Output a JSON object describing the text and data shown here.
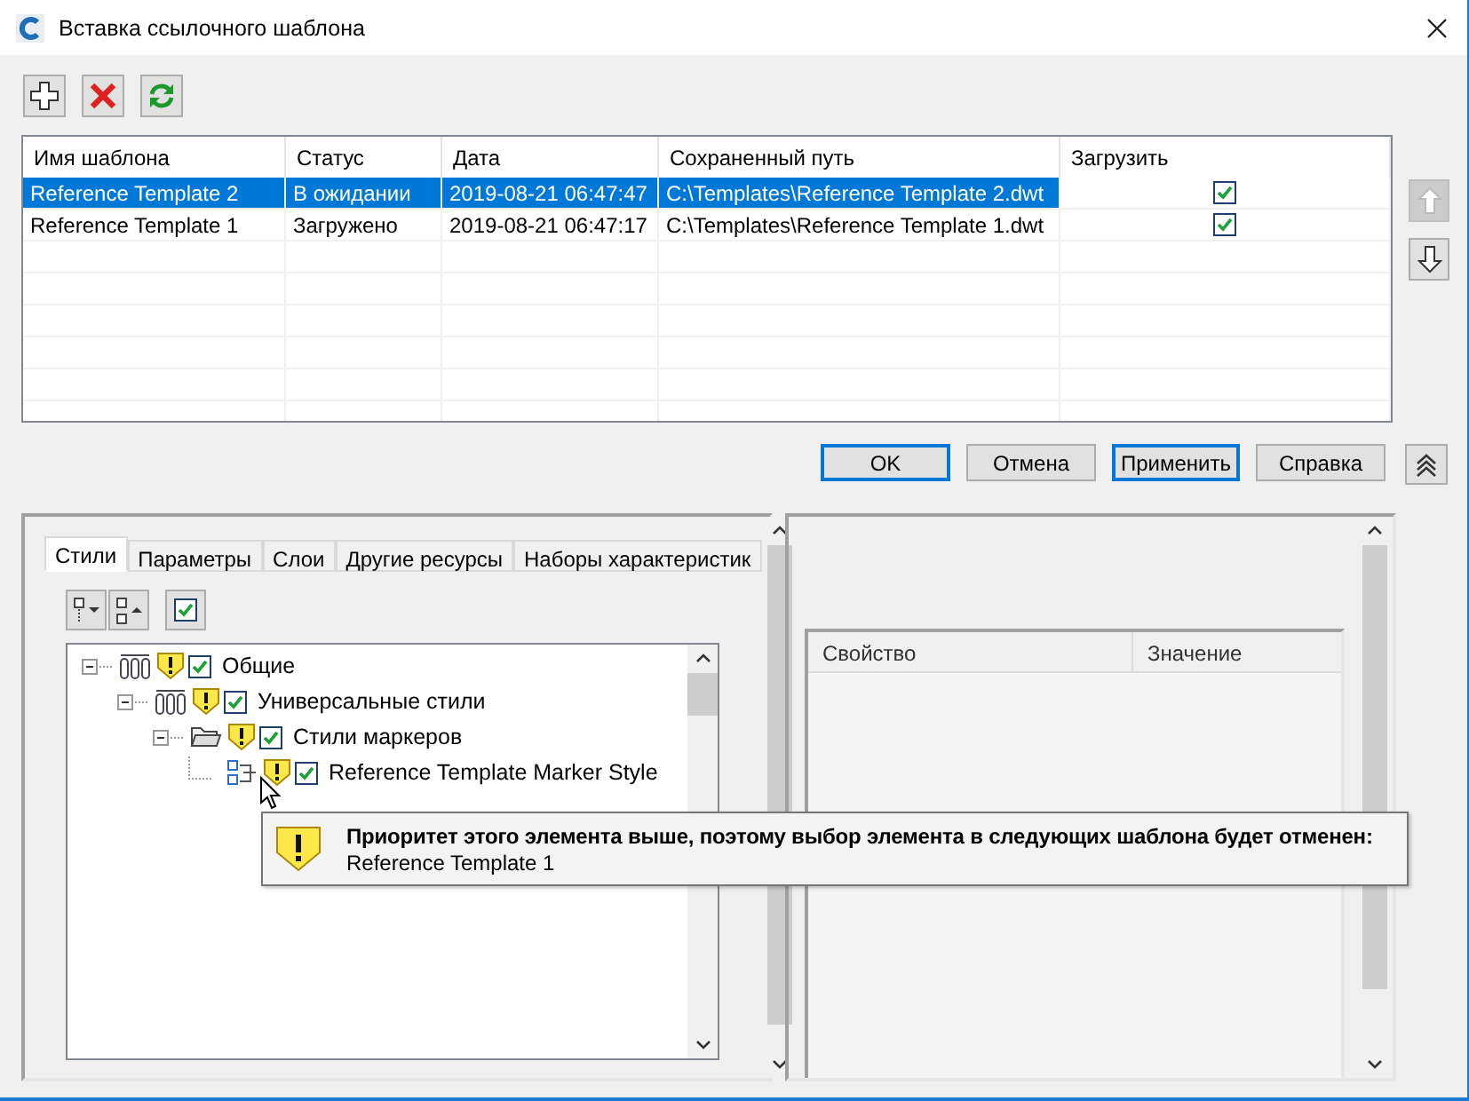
{
  "window": {
    "title": "Вставка ссылочного шаблона"
  },
  "toolbar": [
    {
      "kind": "add"
    },
    {
      "kind": "delete"
    },
    {
      "kind": "refresh"
    }
  ],
  "table": {
    "columns": [
      {
        "label": "Имя шаблона",
        "kind": "name"
      },
      {
        "label": "Статус",
        "kind": "status"
      },
      {
        "label": "Дата",
        "kind": "date"
      },
      {
        "label": "Сохраненный путь",
        "kind": "path"
      },
      {
        "label": "Загрузить",
        "kind": "load"
      }
    ],
    "rows": [
      {
        "name": "Reference Template 2",
        "status": "В ожидании",
        "date": "2019-08-21 06:47:47",
        "path": "C:\\Templates\\Reference Template 2.dwt",
        "load": true,
        "selected": true
      },
      {
        "name": "Reference Template 1",
        "status": "Загружено",
        "date": "2019-08-21 06:47:17",
        "path": "C:\\Templates\\Reference Template 1.dwt",
        "load": true,
        "selected": false
      }
    ]
  },
  "side_buttons": [
    {
      "kind": "up",
      "disabled": true
    },
    {
      "kind": "down",
      "disabled": false
    }
  ],
  "buttons": [
    {
      "label": "OK",
      "focused": true
    },
    {
      "label": "Отмена",
      "focused": false
    },
    {
      "label": "Применить",
      "focused": true
    },
    {
      "label": "Справка",
      "focused": false
    }
  ],
  "tabs": [
    {
      "label": "Стили",
      "selected": true
    },
    {
      "label": "Параметры",
      "selected": false
    },
    {
      "label": "Слои",
      "selected": false
    },
    {
      "label": "Другие ресурсы",
      "selected": false
    },
    {
      "label": "Наборы характеристик",
      "selected": false
    }
  ],
  "tree_toolbar": {
    "check_all": true
  },
  "tree": [
    {
      "label": "Общие",
      "kind": "styles",
      "warning": true,
      "checked": true,
      "expanded": true,
      "children": [
        {
          "label": "Универсальные стили",
          "kind": "styles",
          "warning": true,
          "checked": true,
          "expanded": true,
          "children": [
            {
              "label": "Стили маркеров",
              "kind": "folder",
              "warning": true,
              "checked": true,
              "expanded": true,
              "children": [
                {
                  "label": "Reference Template Marker Style",
                  "kind": "marker",
                  "warning": true,
                  "checked": true
                }
              ]
            }
          ]
        }
      ]
    }
  ],
  "tooltip": {
    "title": "Приоритет этого элемента выше, поэтому выбор элемента в следующих шаблона будет отменен:",
    "text": "Reference Template 1"
  },
  "properties": {
    "columns": [
      "Свойство",
      "Значение"
    ]
  }
}
